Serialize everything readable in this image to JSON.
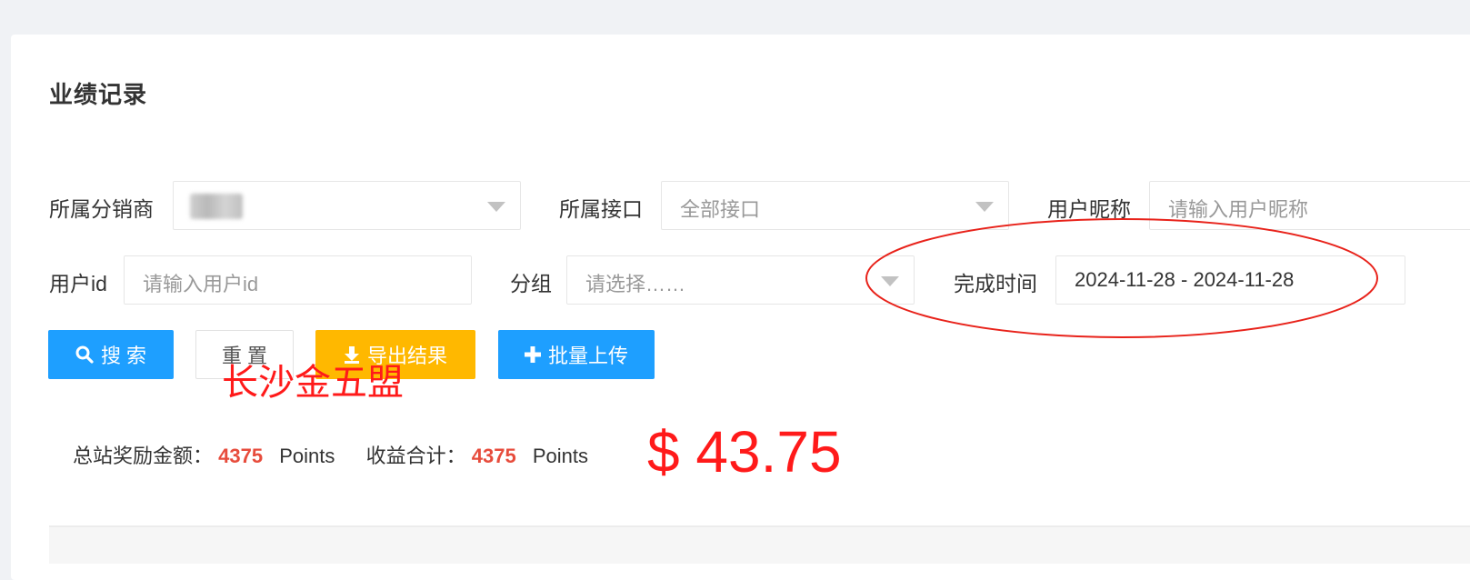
{
  "page": {
    "title": "业绩记录"
  },
  "filters": {
    "distributor_label": "所属分销商",
    "interface_label": "所属接口",
    "interface_value": "全部接口",
    "nickname_label": "用户昵称",
    "nickname_placeholder": "请输入用户昵称",
    "userid_label": "用户id",
    "userid_placeholder": "请输入用户id",
    "group_label": "分组",
    "group_placeholder": "请选择……",
    "time_label": "完成时间",
    "time_value": "2024-11-28 - 2024-11-28"
  },
  "buttons": {
    "search": "搜 索",
    "reset": "重 置",
    "export": "导出结果",
    "upload": "批量上传"
  },
  "stats": {
    "total_reward_label": "总站奖励金额：",
    "total_reward_value": "4375",
    "total_reward_unit": "Points",
    "income_label": "收益合计：",
    "income_value": "4375",
    "income_unit": "Points"
  },
  "annotations": {
    "handwritten_text": "长沙金五盟",
    "amount": "$ 43.75",
    "color": "#ff1a1a"
  },
  "icons": {
    "search": "search-icon",
    "export": "download-icon",
    "upload": "plus-icon"
  }
}
